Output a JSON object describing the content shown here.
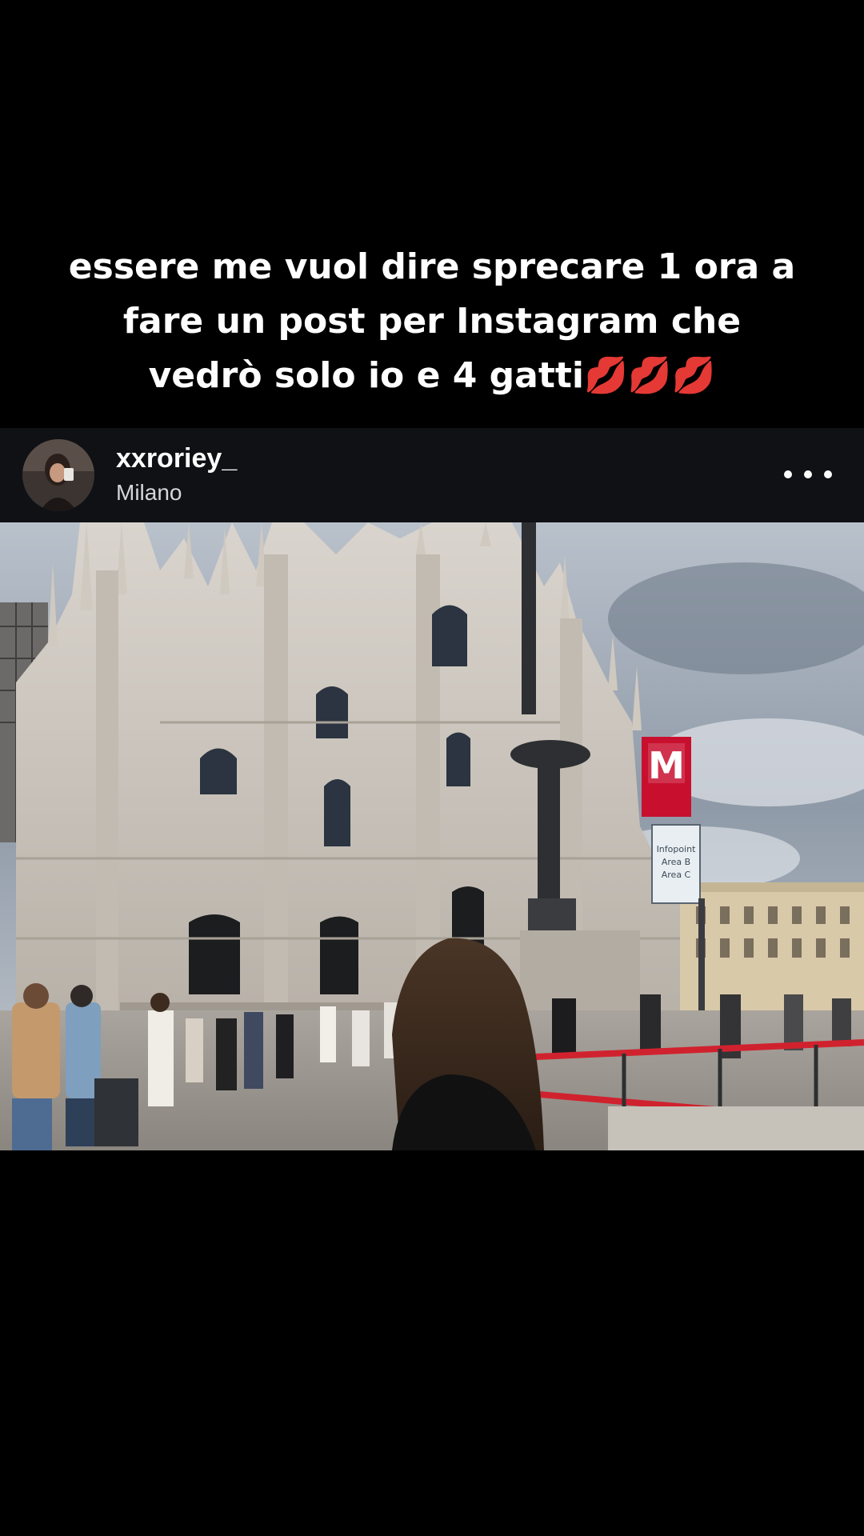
{
  "caption": {
    "text": "essere me vuol dire sprecare 1 ora a\nfare un post per Instagram che\nvedrò solo io e 4 gatti💋💋💋"
  },
  "post": {
    "username": "xxroriey_",
    "location": "Milano",
    "more_icon": "more-horizontal-icon",
    "photo": {
      "metro_sign_letter": "M",
      "info_sign_lines": [
        "Infopoint",
        "Area B",
        "Area C"
      ]
    }
  },
  "colors": {
    "background": "#000000",
    "header_bg": "#0f1115",
    "caption_text": "#ffffff",
    "location_text": "#d6d6d6",
    "metro_red": "#c8102e"
  }
}
